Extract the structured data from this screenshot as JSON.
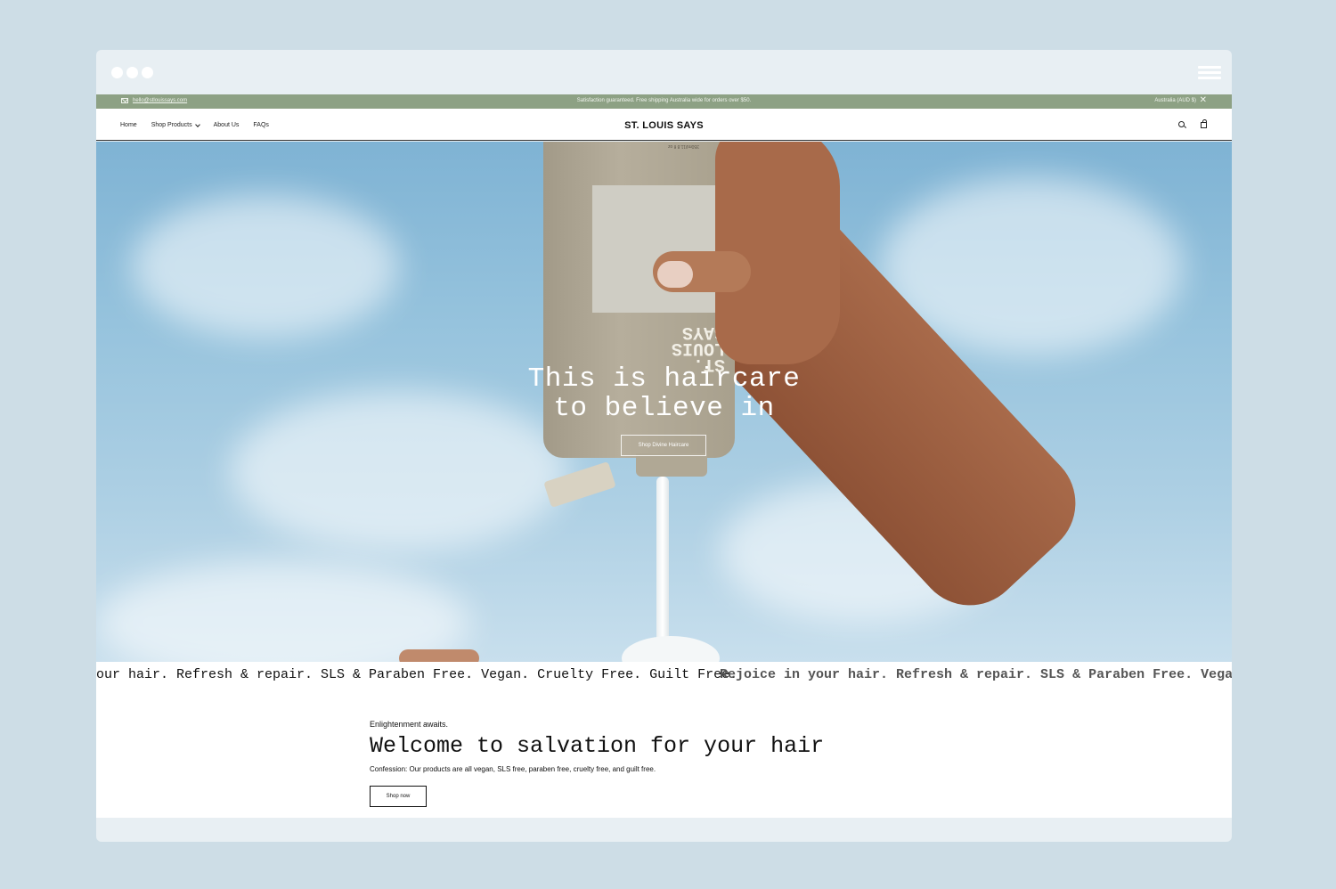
{
  "colors": {
    "background": "#cddde6",
    "announcement_bar": "#8da184",
    "hero_sky": "#96c3dd"
  },
  "window": {
    "menu_icon": "hamburger-menu-icon"
  },
  "announcement": {
    "email": "hello@stlouissays.com",
    "message": "Satisfaction guaranteed. Free shipping Australia wide for orders over $50.",
    "region": "Australia (AUD $)",
    "close": "✕"
  },
  "nav": {
    "items": [
      "Home",
      "Shop Products",
      "About Us",
      "FAQs"
    ],
    "logo": "ST. LOUIS SAYS",
    "icons": [
      "search-icon",
      "bag-icon"
    ]
  },
  "hero": {
    "title_line1": "This is haircare",
    "title_line2": "to believe in",
    "button": "Shop Divine Haircare",
    "bottle_brand": "ST. LOUIS SAYS",
    "bottle_volume": "350ml/11.8 fl oz"
  },
  "marquee": {
    "text1": "our hair. Refresh & repair. SLS & Paraben Free. Vegan. Cruelty Free. Guilt Free.",
    "text2": "Rejoice in your hair. Refresh & repair. SLS & Paraben Free. Vegan. C"
  },
  "welcome": {
    "kicker": "Enlightenment awaits.",
    "title": "Welcome to salvation for your hair",
    "subtitle": "Confession: Our products are all vegan, SLS free, paraben free, cruelty free, and guilt free.",
    "button": "Shop now"
  }
}
